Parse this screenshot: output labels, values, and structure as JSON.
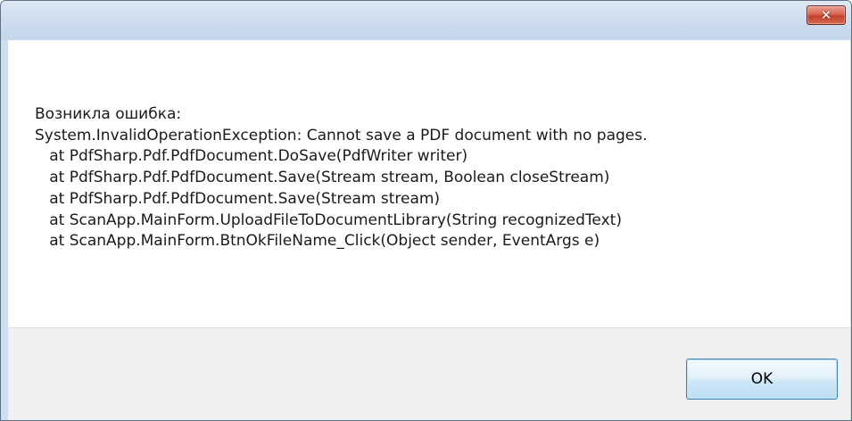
{
  "dialog": {
    "close_icon": "✕",
    "message_lines": [
      "Возникла ошибка:",
      "System.InvalidOperationException: Cannot save a PDF document with no pages.",
      "   at PdfSharp.Pdf.PdfDocument.DoSave(PdfWriter writer)",
      "   at PdfSharp.Pdf.PdfDocument.Save(Stream stream, Boolean closeStream)",
      "   at PdfSharp.Pdf.PdfDocument.Save(Stream stream)",
      "   at ScanApp.MainForm.UploadFileToDocumentLibrary(String recognizedText)",
      "   at ScanApp.MainForm.BtnOkFileName_Click(Object sender, EventArgs e)"
    ],
    "ok_label": "OK"
  },
  "icons": {
    "close": "close-icon"
  },
  "colors": {
    "titlebar": "#cddcee",
    "close_button": "#c4402a",
    "ok_border": "#3c7fb1",
    "footer": "#f0f0f0"
  }
}
